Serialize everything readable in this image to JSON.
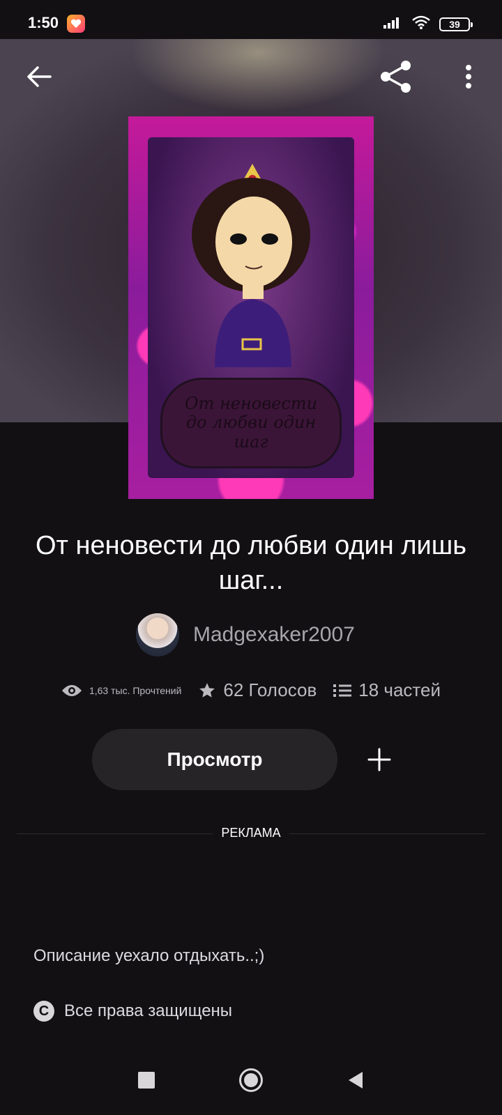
{
  "status_bar": {
    "time": "1:50",
    "battery": "39"
  },
  "story": {
    "title": "От неновести до любви один лишь шаг...",
    "cover_text": "От неновести до любви один шаг",
    "author": "Madgexaker2007",
    "reads": "1,63 тыс. Прочтений",
    "votes": "62 Голосов",
    "parts": "18 частей",
    "view_button": "Просмотр",
    "description": "Описание уехало отдыхать..;)",
    "rights": "Все права защищены"
  },
  "ad": {
    "label": "РЕКЛАМА"
  },
  "icons": {
    "back": "back-arrow-icon",
    "share": "share-icon",
    "more": "more-vertical-icon",
    "eye": "eye-icon",
    "star": "star-icon",
    "list": "list-icon",
    "add": "plus-icon",
    "copyright": "copyright-icon"
  },
  "colors": {
    "background": "#121013",
    "button_bg": "#262427",
    "muted_text": "#bdbabf",
    "author_text": "#a9a6ab"
  }
}
